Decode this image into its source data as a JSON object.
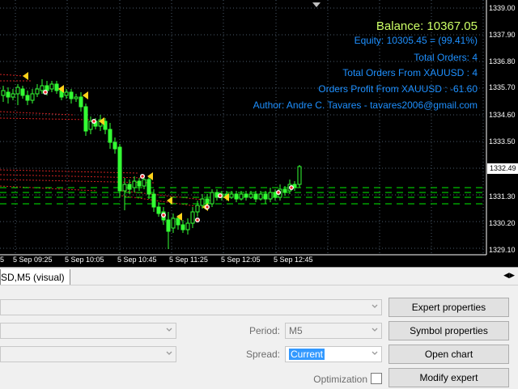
{
  "chart": {
    "price_labels": [
      "1339.00",
      "1337.90",
      "1336.80",
      "1335.70",
      "1334.60",
      "1333.50",
      "1332.49",
      "1331.30",
      "1330.20",
      "1329.10"
    ],
    "current_price": "1332.49",
    "time_labels": [
      "5",
      "5 Sep 09:25",
      "5 Sep 10:05",
      "5 Sep 10:45",
      "5 Sep 11:25",
      "5 Sep 12:05",
      "5 Sep 12:45"
    ],
    "colors": {
      "background": "#000000",
      "grid": "#4a5a6a",
      "candle": "#33ff33",
      "level": "#00ee00",
      "order": "#cc2222",
      "arrow": "#ffd21a"
    }
  },
  "info": {
    "balance": "Balance: 10367.05",
    "equity": "Equity: 10305.45 = (99.41%)",
    "total_orders": "Total Orders: 4",
    "total_orders_symbol": "Total Orders From XAUUSD : 4",
    "orders_profit": "Orders Profit From XAUUSD : -61.60",
    "author": "Author: Andre C. Tavares - tavares2006@gmail.com",
    "colors": {
      "balance": "#ccff66",
      "text": "#1e90ff"
    }
  },
  "tab": {
    "label": "SD,M5 (visual)"
  },
  "tester": {
    "period_label": "Period:",
    "period_value": "M5",
    "spread_label": "Spread:",
    "spread_value": "Current",
    "optimization_label": "Optimization",
    "buttons": {
      "expert_properties": "Expert properties",
      "symbol_properties": "Symbol properties",
      "open_chart": "Open chart",
      "modify_expert": "Modify expert"
    }
  }
}
